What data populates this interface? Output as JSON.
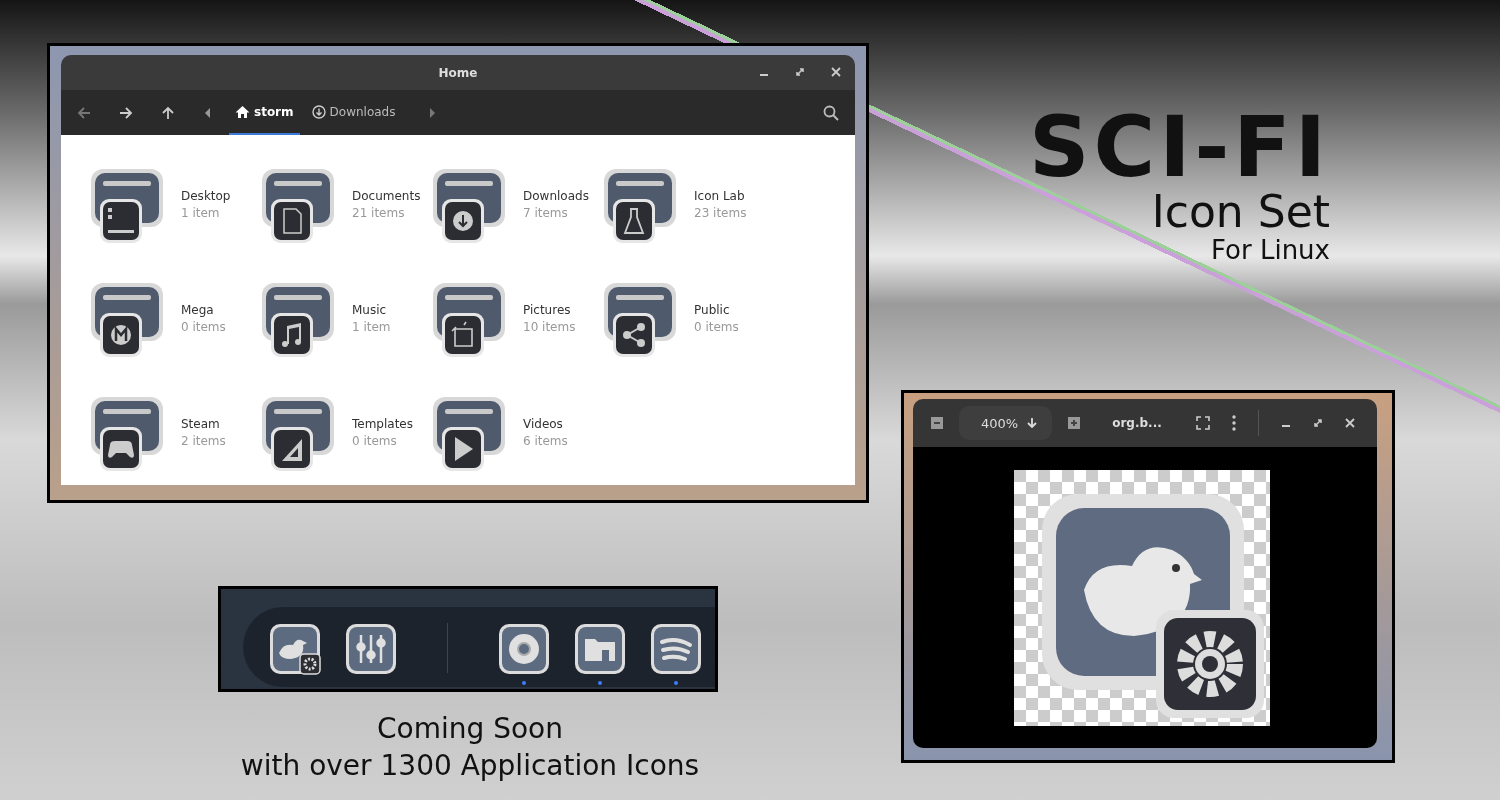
{
  "file_manager": {
    "title": "Home",
    "path": [
      {
        "kind": "home",
        "label": "storm",
        "selected": true
      },
      {
        "kind": "download",
        "label": "Downloads",
        "selected": false
      }
    ],
    "folders": [
      {
        "kind": "desktop",
        "name": "Desktop",
        "count": "1 item"
      },
      {
        "kind": "document",
        "name": "Documents",
        "count": "21 items"
      },
      {
        "kind": "download",
        "name": "Downloads",
        "count": "7 items"
      },
      {
        "kind": "flask",
        "name": "Icon Lab",
        "count": "23 items"
      },
      {
        "kind": "mega",
        "name": "Mega",
        "count": "0 items"
      },
      {
        "kind": "music",
        "name": "Music",
        "count": "1 item"
      },
      {
        "kind": "picture",
        "name": "Pictures",
        "count": "10 items"
      },
      {
        "kind": "share",
        "name": "Public",
        "count": "0 items"
      },
      {
        "kind": "gamepad",
        "name": "Steam",
        "count": "2 items"
      },
      {
        "kind": "ruler",
        "name": "Templates",
        "count": "0 items"
      },
      {
        "kind": "play",
        "name": "Videos",
        "count": "6 items"
      }
    ]
  },
  "image_viewer": {
    "zoom": "400%",
    "filename": "org.b..."
  },
  "dock": {
    "apps": [
      {
        "kind": "bird",
        "running": false
      },
      {
        "kind": "sliders",
        "running": false
      },
      {
        "kind": "browser",
        "running": true
      },
      {
        "kind": "folder",
        "running": true
      },
      {
        "kind": "waves",
        "running": true
      }
    ]
  },
  "headline": {
    "title": "SCI-FI",
    "subtitle": "Icon Set",
    "platform": "For Linux"
  },
  "tagline": [
    "Coming Soon",
    "with over 1300 Application Icons"
  ]
}
